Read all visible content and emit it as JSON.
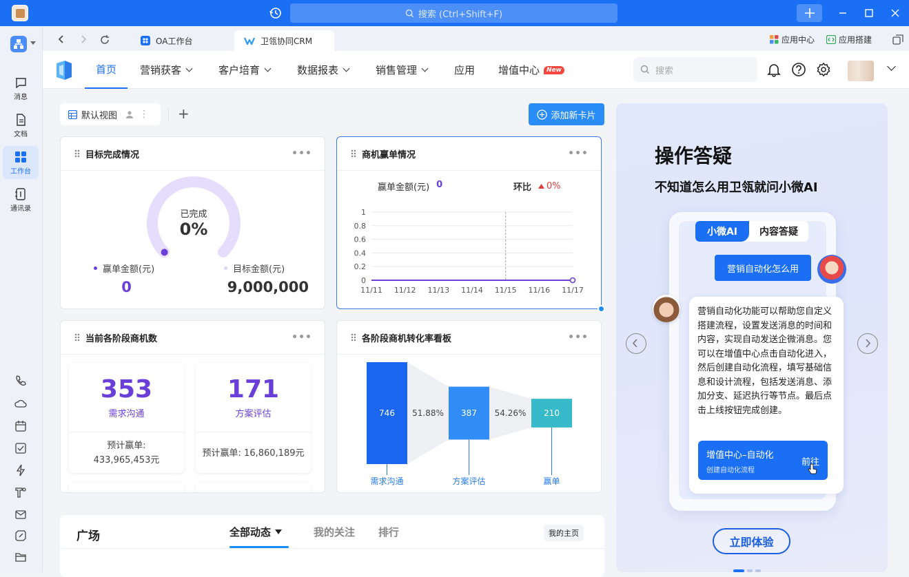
{
  "titlebar": {
    "search_placeholder": "搜索 (Ctrl+Shift+F)"
  },
  "sidebar": {
    "items": [
      {
        "label": "消息",
        "icon": "message-icon"
      },
      {
        "label": "文档",
        "icon": "document-icon"
      },
      {
        "label": "工作台",
        "icon": "workbench-icon",
        "active": true
      },
      {
        "label": "通讯录",
        "icon": "contacts-icon"
      }
    ],
    "tools": [
      "phone-icon",
      "cloud-icon",
      "calendar-icon",
      "task-check-icon",
      "lightning-icon",
      "tool-icon",
      "mail-icon",
      "edit-square-icon",
      "folder-icon"
    ]
  },
  "tabs": {
    "items": [
      {
        "label": "OA工作台"
      },
      {
        "label": "卫瓴协同CRM",
        "active": true
      }
    ],
    "right": {
      "app_center": "应用中心",
      "app_build": "应用搭建"
    }
  },
  "nav": {
    "items": [
      "首页",
      "营销获客",
      "客户培育",
      "数据报表",
      "销售管理",
      "应用",
      "增值中心"
    ],
    "new_badge": "New",
    "search_placeholder": "搜索"
  },
  "view": {
    "name": "默认视图",
    "add_card": "添加新卡片"
  },
  "cards": {
    "target": {
      "title": "目标完成情况",
      "gauge_label": "已完成",
      "gauge_value": "0%",
      "progress": 0,
      "won_label": "赢单金额(元)",
      "won_value": "0",
      "target_label": "目标金额(元)",
      "target_value": "9,000,000"
    },
    "win": {
      "title": "商机赢单情况",
      "amount_label": "赢单金额(元)",
      "amount_value": "0",
      "ratio_label": "环比",
      "ratio_value": "0%"
    },
    "stages": {
      "title": "当前各阶段商机数",
      "items": [
        {
          "count": "353",
          "name": "需求沟通",
          "forecast_label": "预计赢单:",
          "forecast_value": "433,965,453元"
        },
        {
          "count": "171",
          "name": "方案评估",
          "forecast_label": "预计赢单:",
          "forecast_value": "16,860,189元"
        }
      ]
    },
    "funnel": {
      "title": "各阶段商机转化率看板"
    }
  },
  "chart_data": [
    {
      "type": "line",
      "title": "",
      "x": [
        "11/11",
        "11/12",
        "11/13",
        "11/14",
        "11/15",
        "11/16",
        "11/17"
      ],
      "y_ticks": [
        "1",
        "0.8",
        "0.6",
        "0.4",
        "0.2",
        "0"
      ],
      "series": [
        {
          "values": [
            0,
            0,
            0,
            0,
            0,
            0,
            0
          ]
        }
      ],
      "ylim": [
        0,
        1
      ],
      "grid": true,
      "line_color": "#6a3fd8"
    },
    {
      "type": "bar",
      "title": "",
      "categories": [
        "需求沟通",
        "方案评估",
        "赢单"
      ],
      "values": [
        746,
        387,
        210
      ],
      "value_labels": [
        "746",
        "387",
        "210"
      ],
      "conversion_rates": [
        "51.88%",
        "54.26%"
      ],
      "colors": [
        "#1a66f0",
        "#2f8df5",
        "#36b9c9"
      ]
    }
  ],
  "promo": {
    "heading": "操作答疑",
    "subheading": "不知道怎么用卫瓴就问小微AI",
    "tab_active": "小微AI",
    "tab_other": "内容答疑",
    "question": "营销自动化怎么用",
    "answer": "营销自动化功能可以帮助您自定义搭建流程，设置发送消息的时间和内容，实现自动发送企微消息。您可以在增值中心点击自动化进入，然后创建自动化流程，填写基础信息和设计流程，包括发送消息、添加分支、延迟执行等节点。最后点击上线按钮完成创建。",
    "cta_title": "增值中心–自动化",
    "cta_sub": "创建自动化流程",
    "cta_go": "前往",
    "try_button": "立即体验"
  },
  "plaza": {
    "title": "广场",
    "tabs": [
      "全部动态",
      "我的关注",
      "排行"
    ],
    "my_home": "我的主页"
  }
}
